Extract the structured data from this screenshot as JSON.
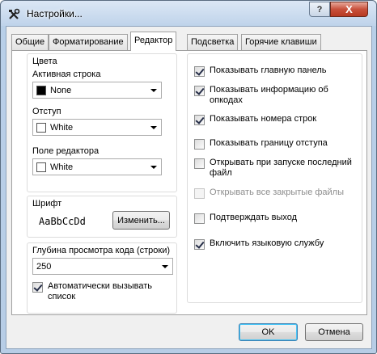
{
  "window": {
    "title": "Настройки...",
    "help_label": "?",
    "close_label": "X"
  },
  "tabs": [
    "Общие",
    "Форматирование",
    "Редактор",
    "Подсветка",
    "Горячие клавиши"
  ],
  "colors": {
    "title": "Цвета",
    "active_line_label": "Активная строка",
    "active_line_value": "None",
    "active_line_swatch": "#000000",
    "indent_label": "Отступ",
    "indent_value": "White",
    "indent_swatch": "#ffffff",
    "editor_field_label": "Поле редактора",
    "editor_field_value": "White",
    "editor_field_swatch": "#ffffff"
  },
  "font": {
    "title": "Шрифт",
    "sample": "AaBbCcDd",
    "change_label": "Изменить..."
  },
  "code_depth": {
    "title": "Глубина просмотра кода (строки)",
    "value": "250",
    "auto_list_label": "Автоматически вызывать список",
    "auto_list_checked": true
  },
  "options": [
    {
      "label": "Показывать главную панель",
      "checked": true,
      "enabled": true
    },
    {
      "label": "Показывать информацию об опкодах",
      "checked": true,
      "enabled": true
    },
    {
      "label": "Показывать номера строк",
      "checked": true,
      "enabled": true
    },
    {
      "label": "Показывать границу отступа",
      "checked": false,
      "enabled": true
    },
    {
      "label": "Открывать при запуске последний файл",
      "checked": false,
      "enabled": true
    },
    {
      "label": "Открывать все закрытые файлы",
      "checked": false,
      "enabled": false
    },
    {
      "label": "Подтверждать выход",
      "checked": false,
      "enabled": true
    },
    {
      "label": "Включить языковую службу",
      "checked": true,
      "enabled": true
    }
  ],
  "footer": {
    "ok_label": "OK",
    "cancel_label": "Отмена"
  }
}
